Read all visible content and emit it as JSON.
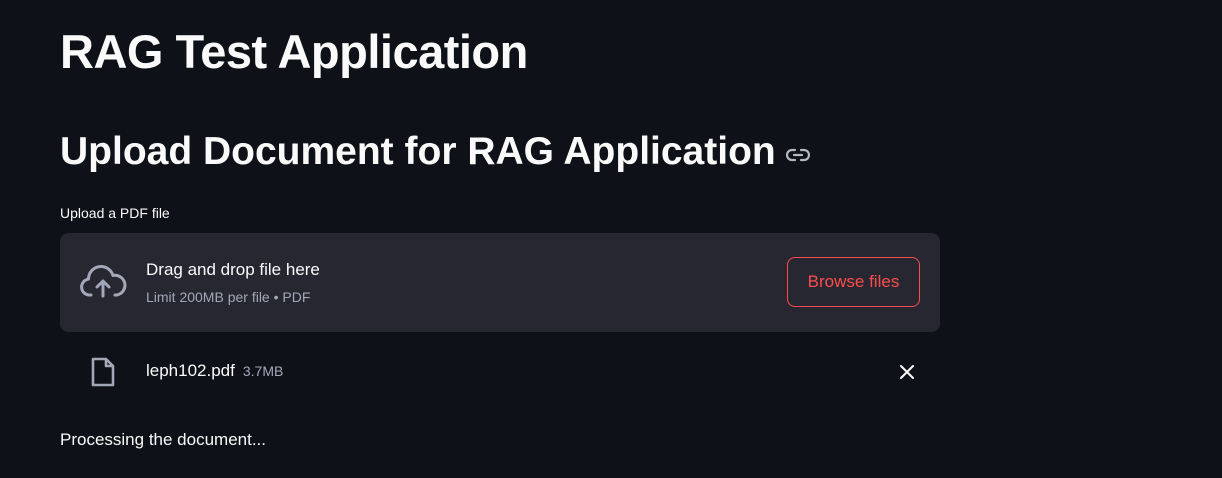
{
  "app": {
    "title": "RAG Test Application"
  },
  "section": {
    "heading": "Upload Document for RAG Application",
    "anchor_icon": "link-icon"
  },
  "uploader": {
    "label": "Upload a PDF file",
    "dropzone": {
      "icon": "cloud-upload-icon",
      "instruction": "Drag and drop file here",
      "limit": "Limit 200MB per file • PDF"
    },
    "browse_button": "Browse files",
    "uploaded_file": {
      "icon": "file-icon",
      "name": "leph102.pdf",
      "size": "3.7MB",
      "remove_icon": "close-icon"
    }
  },
  "status": {
    "message": "Processing the document..."
  },
  "colors": {
    "background": "#0e1117",
    "surface": "#262730",
    "accent": "#ff4b4b",
    "text": "#fafafa",
    "muted_text": "#a3a8b8"
  }
}
